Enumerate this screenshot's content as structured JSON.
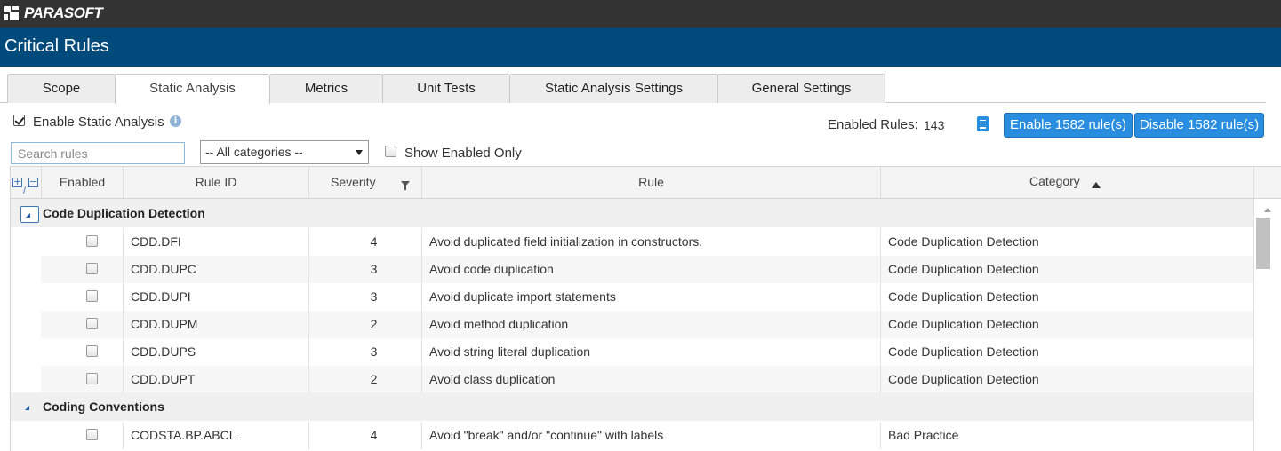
{
  "brand": {
    "name": "PARASOFT"
  },
  "page": {
    "title": "Critical Rules"
  },
  "tabs": [
    {
      "label": "Scope"
    },
    {
      "label": "Static Analysis"
    },
    {
      "label": "Metrics"
    },
    {
      "label": "Unit Tests"
    },
    {
      "label": "Static Analysis Settings"
    },
    {
      "label": "General Settings"
    }
  ],
  "toolbar": {
    "enable_static_analysis_label": "Enable Static Analysis",
    "enabled_rules_label": "Enabled Rules:",
    "enabled_rules_count": "143",
    "enable_button": "Enable 1582 rule(s)",
    "disable_button": "Disable 1582 rule(s)",
    "search_placeholder": "Search rules",
    "category_select": "-- All categories --",
    "show_enabled_only_label": "Show Enabled Only"
  },
  "grid": {
    "columns": [
      "Enabled",
      "Rule ID",
      "Severity",
      "Rule",
      "Category"
    ],
    "groups": [
      {
        "name": "Code Duplication Detection",
        "rows": [
          {
            "id": "CDD.DFI",
            "severity": "4",
            "rule": "Avoid duplicated field initialization in constructors.",
            "category": "Code Duplication Detection"
          },
          {
            "id": "CDD.DUPC",
            "severity": "3",
            "rule": "Avoid code duplication",
            "category": "Code Duplication Detection"
          },
          {
            "id": "CDD.DUPI",
            "severity": "3",
            "rule": "Avoid duplicate import statements",
            "category": "Code Duplication Detection"
          },
          {
            "id": "CDD.DUPM",
            "severity": "2",
            "rule": "Avoid method duplication",
            "category": "Code Duplication Detection"
          },
          {
            "id": "CDD.DUPS",
            "severity": "3",
            "rule": "Avoid string literal duplication",
            "category": "Code Duplication Detection"
          },
          {
            "id": "CDD.DUPT",
            "severity": "2",
            "rule": "Avoid class duplication",
            "category": "Code Duplication Detection"
          }
        ]
      },
      {
        "name": "Coding Conventions",
        "rows": [
          {
            "id": "CODSTA.BP.ABCL",
            "severity": "4",
            "rule": "Avoid \"break\" and/or \"continue\" with labels",
            "category": "Bad Practice"
          }
        ]
      }
    ]
  },
  "colors": {
    "header_bar": "#004a7c",
    "top_bar": "#333333",
    "button_blue": "#2a8ee0"
  }
}
